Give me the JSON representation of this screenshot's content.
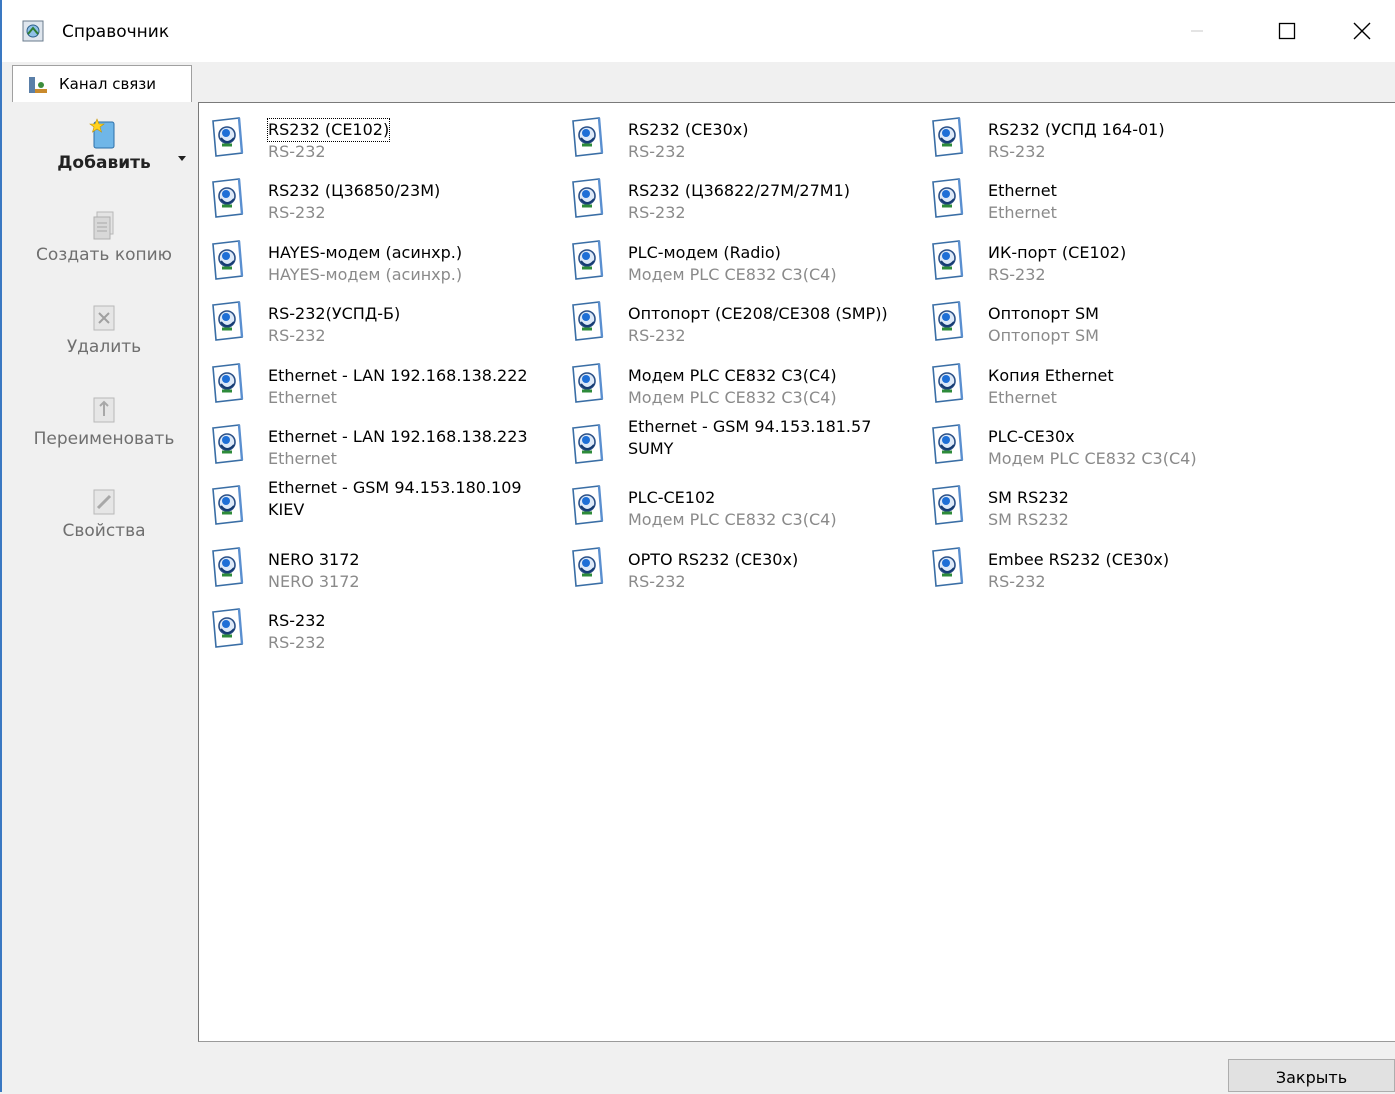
{
  "window": {
    "title": "Справочник",
    "controls": {
      "minimize": "—",
      "maximize": "☐",
      "close": "✕"
    }
  },
  "tab": {
    "label": "Канал связи"
  },
  "toolbar": {
    "add_label": "Добавить",
    "copy_label": "Создать копию",
    "delete_label": "Удалить",
    "rename_label": "Переименовать",
    "properties_label": "Свойства"
  },
  "items": [
    {
      "name": "RS232 (CE102)",
      "sub": "RS-232"
    },
    {
      "name": "RS232 (CE30x)",
      "sub": "RS-232"
    },
    {
      "name": "RS232 (УСПД 164-01)",
      "sub": "RS-232"
    },
    {
      "name": "RS232 (Ц36850/23М)",
      "sub": "RS-232"
    },
    {
      "name": "RS232 (Ц36822/27М/27М1)",
      "sub": "RS-232"
    },
    {
      "name": "Ethernet",
      "sub": "Ethernet"
    },
    {
      "name": "HAYES-модем (асинхр.)",
      "sub": "HAYES-модем (асинхр.)"
    },
    {
      "name": "PLC-модем (Radio)",
      "sub": "Модем PLC CE832 C3(C4)"
    },
    {
      "name": "ИК-порт (CE102)",
      "sub": "RS-232"
    },
    {
      "name": "RS-232(УСПД-Б)",
      "sub": "RS-232"
    },
    {
      "name": "Оптопорт (CE208/CE308 (SMP))",
      "sub": "RS-232"
    },
    {
      "name": "Оптопорт SM",
      "sub": "Оптопорт SM"
    },
    {
      "name": "Ethernet - LAN 192.168.138.222",
      "sub": "Ethernet"
    },
    {
      "name": "Модем PLC CE832 C3(C4)",
      "sub": "Модем PLC CE832 C3(C4)"
    },
    {
      "name": "Копия Ethernet",
      "sub": "Ethernet"
    },
    {
      "name": "Ethernet - LAN 192.168.138.223",
      "sub": "Ethernet"
    },
    {
      "name": "Ethernet - GSM 94.153.181.57",
      "sub": "SUMY"
    },
    {
      "name": "PLC-CE30x",
      "sub": "Модем PLC CE832 C3(C4)"
    },
    {
      "name": "Ethernet - GSM 94.153.180.109",
      "sub": "KIEV"
    },
    {
      "name": "PLC-CE102",
      "sub": "Модем PLC CE832 C3(C4)"
    },
    {
      "name": "SM RS232",
      "sub": "SM RS232"
    },
    {
      "name": "NERO 3172",
      "sub": "NERO 3172"
    },
    {
      "name": "OPTO RS232 (CE30x)",
      "sub": "RS-232"
    },
    {
      "name": "Embee RS232 (CE30x)",
      "sub": "RS-232"
    },
    {
      "name": "RS-232",
      "sub": "RS-232"
    }
  ],
  "footer": {
    "close_label": "Закрыть"
  }
}
